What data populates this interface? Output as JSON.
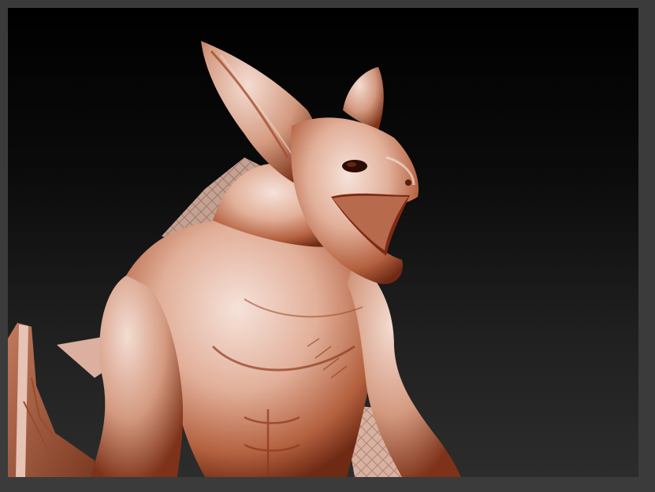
{
  "app": {
    "window_title": ""
  },
  "viewport": {
    "background_top": "#000000",
    "background_bottom": "#2c2c2c",
    "frame_color": "#3b3b3b"
  },
  "model": {
    "material_color_light": "#f1d7cc",
    "material_color_mid": "#c98a6e",
    "material_color_dark": "#7a2f18"
  }
}
